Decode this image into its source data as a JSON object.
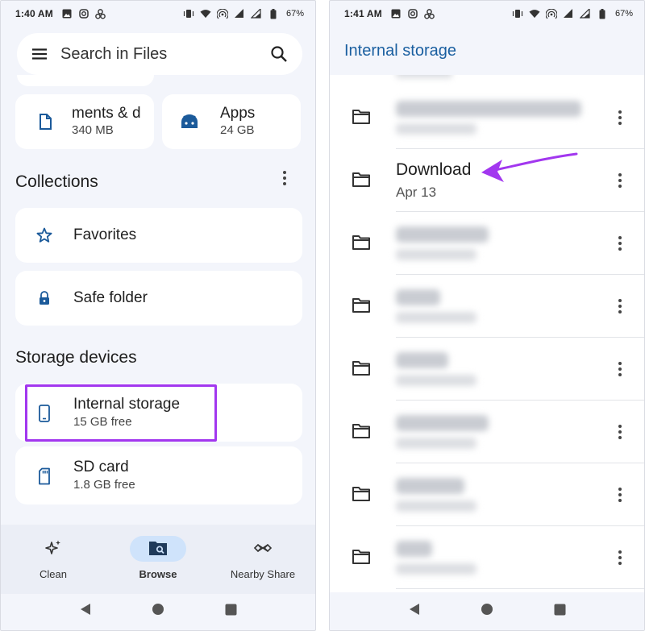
{
  "left": {
    "status": {
      "time": "1:40 AM",
      "battery": "67%"
    },
    "search": {
      "placeholder": "Search in Files"
    },
    "categories": [
      {
        "title": "ments & d",
        "size": "340 MB",
        "icon": "document-icon"
      },
      {
        "title": "Apps",
        "size": "24 GB",
        "icon": "android-app-icon"
      }
    ],
    "collections": {
      "title": "Collections",
      "items": [
        {
          "label": "Favorites",
          "icon": "star-icon"
        },
        {
          "label": "Safe folder",
          "icon": "lock-icon"
        }
      ]
    },
    "storage": {
      "title": "Storage devices",
      "items": [
        {
          "title": "Internal storage",
          "subtitle": "15 GB free",
          "icon": "phone-icon"
        },
        {
          "title": "SD card",
          "subtitle": "1.8 GB free",
          "icon": "sd-card-icon"
        }
      ]
    },
    "nav": [
      {
        "label": "Clean",
        "icon": "sparkle-icon",
        "active": false
      },
      {
        "label": "Browse",
        "icon": "browse-folder-icon",
        "active": true
      },
      {
        "label": "Nearby Share",
        "icon": "nearby-share-icon",
        "active": false
      }
    ]
  },
  "right": {
    "status": {
      "time": "1:41 AM",
      "battery": "67%"
    },
    "title": "Internal storage",
    "folders": [
      {
        "name": "",
        "date": "",
        "blurred": true
      },
      {
        "name": "Download",
        "date": "Apr 13",
        "blurred": false
      },
      {
        "name": "",
        "date": "",
        "blurred": true
      },
      {
        "name": "",
        "date": "",
        "blurred": true
      },
      {
        "name": "",
        "date": "",
        "blurred": true
      },
      {
        "name": "",
        "date": "",
        "blurred": true
      },
      {
        "name": "",
        "date": "",
        "blurred": true
      },
      {
        "name": "",
        "date": "",
        "blurred": true
      }
    ]
  },
  "colors": {
    "highlight": "#a237ef",
    "accent": "#1a5fa0",
    "icon_blue": "#1b5a9a"
  }
}
